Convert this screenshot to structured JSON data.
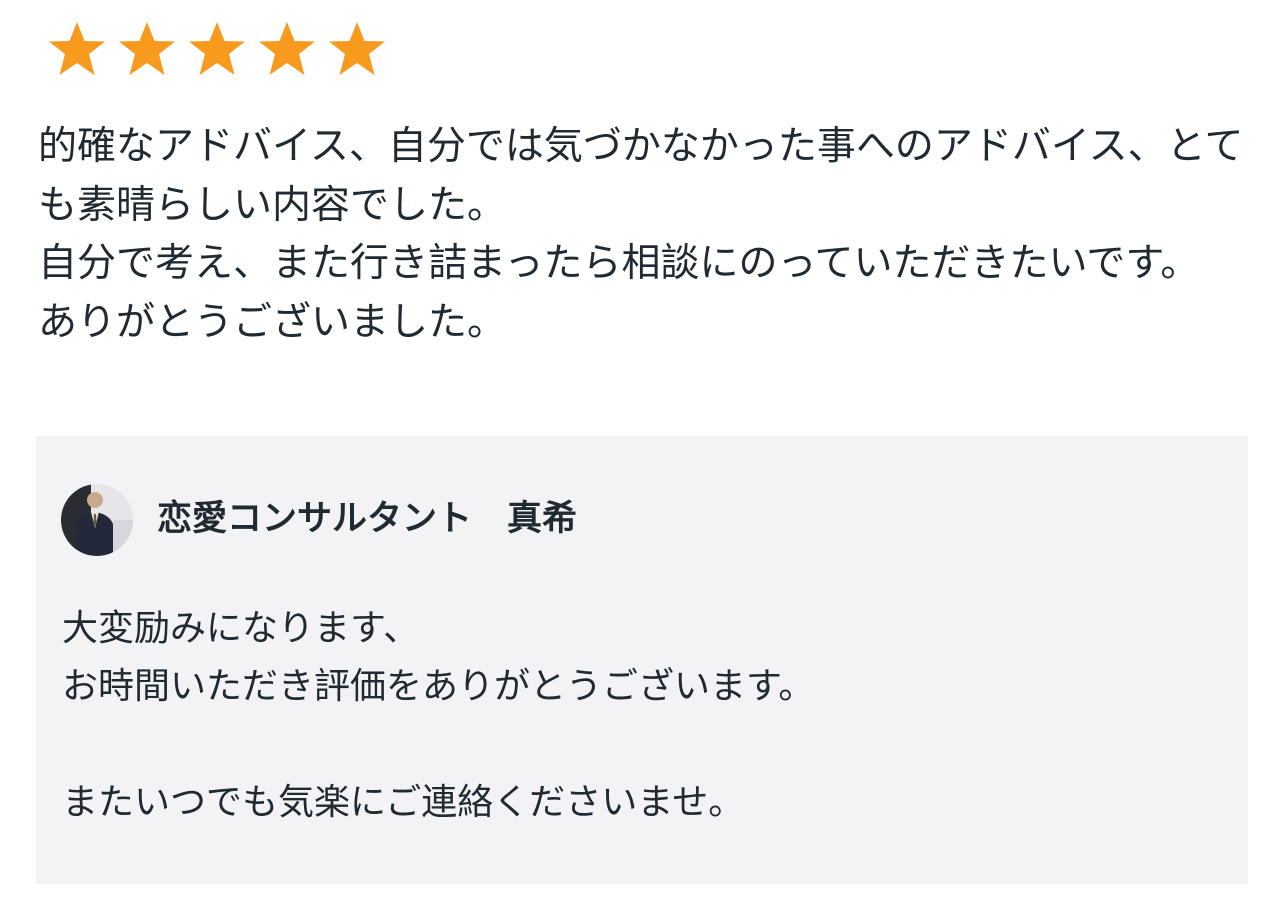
{
  "rating": {
    "value": 5,
    "max": 5,
    "star_color": "#F79A1E",
    "icon": "star-icon"
  },
  "review": {
    "paragraphs": [
      "的確なアドバイス、自分では気づかなかった事へのアドバイス、とても素晴らしい内容でした。",
      "自分で考え、また行き詰まったら相談にのっていただきたいです。",
      "ありがとうございました。"
    ]
  },
  "reply": {
    "author_name": "恋愛コンサルタント　真希",
    "avatar_icon": "avatar-icon",
    "lines": [
      "大変励みになります、",
      "お時間いただき評価をありがとうございます。",
      "",
      "またいつでも気楽にご連絡くださいませ。"
    ],
    "background_color": "#F3F3F6"
  }
}
